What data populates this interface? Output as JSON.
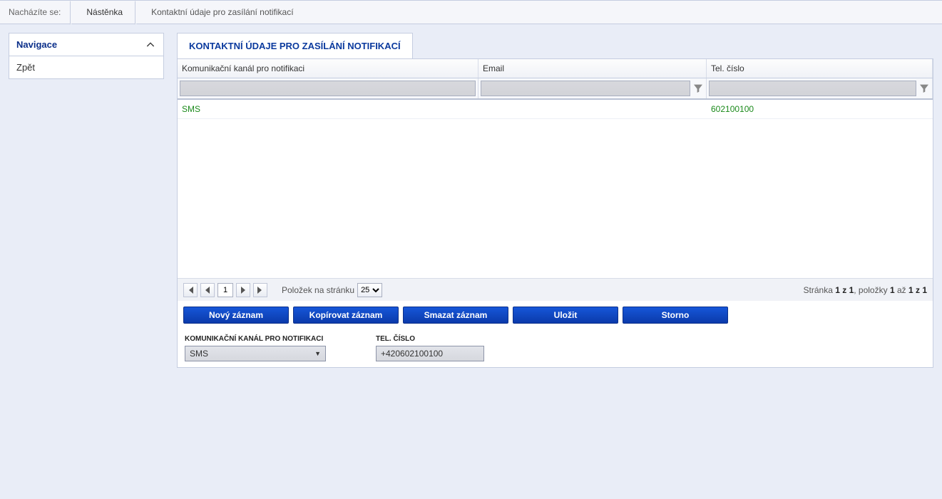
{
  "breadcrumb": {
    "label": "Nacházíte se:",
    "crumbs": [
      "Nástěnka",
      "Kontaktní údaje pro zasílání notifikací"
    ]
  },
  "sidebar": {
    "title": "Navigace",
    "items": [
      {
        "label": "Zpět"
      }
    ]
  },
  "main": {
    "tab": "KONTAKTNÍ ÚDAJE PRO ZASÍLÁNÍ NOTIFIKACÍ",
    "grid": {
      "headers": {
        "channel": "Komunikační kanál pro notifikaci",
        "email": "Email",
        "tel": "Tel. číslo"
      },
      "rows": [
        {
          "channel": "SMS",
          "email": "",
          "tel": "602100100",
          "selected": true
        }
      ]
    },
    "pager": {
      "page": "1",
      "per_page_label": "Položek na stránku",
      "per_page_value": "25",
      "info_prefix": "Stránka ",
      "info_page": "1 z 1",
      "info_mid": ", položky ",
      "info_from": "1",
      "info_to_word": " až ",
      "info_to": "1 z 1"
    },
    "actions": {
      "new": "Nový záznam",
      "copy": "Kopírovat záznam",
      "delete": "Smazat záznam",
      "save": "Uložit",
      "cancel": "Storno"
    },
    "form": {
      "channel_label": "KOMUNIKAČNÍ KANÁL PRO NOTIFIKACI",
      "channel_value": "SMS",
      "tel_label": "TEL. ČÍSLO",
      "tel_value": "+420602100100"
    }
  }
}
